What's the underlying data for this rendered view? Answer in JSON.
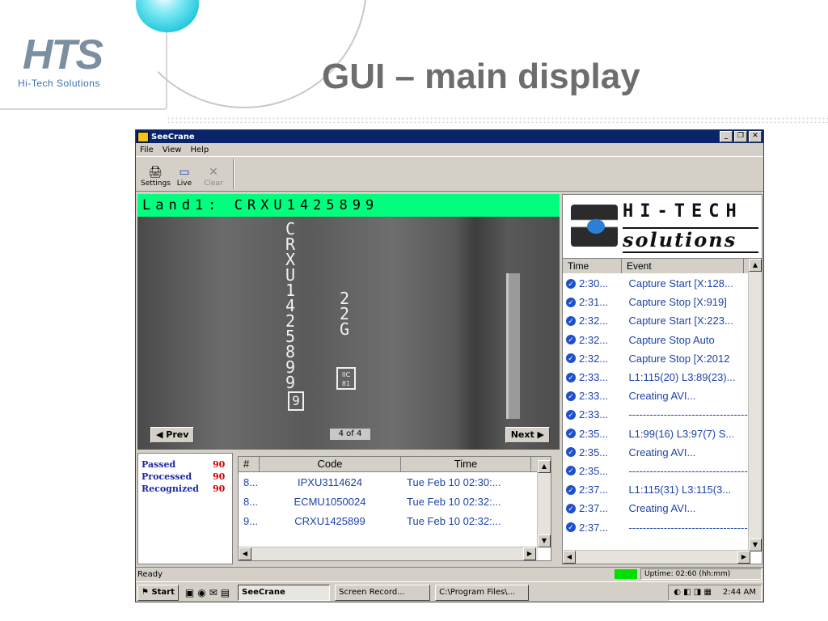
{
  "slide": {
    "logo_mark": "HTS",
    "logo_subtitle": "Hi-Tech Solutions",
    "title": "GUI – main display"
  },
  "window": {
    "title": "SeeCrane",
    "menu": [
      "File",
      "View",
      "Help"
    ],
    "toolbar": {
      "settings": "Settings",
      "live": "Live",
      "clear": "Clear"
    }
  },
  "video": {
    "plate_label": "Land1:  CRXU1425899",
    "vertical_code": "CRXU1425899",
    "side_code": "22G",
    "check_digit": "9",
    "iic_top": "IIC",
    "iic_bottom": "81",
    "prev_label": "◀ Prev",
    "next_label": "Next ▶",
    "counter": "4  of  4"
  },
  "brand": {
    "line1": "HI-TECH",
    "line2": "solutions"
  },
  "events": {
    "columns": [
      "Time",
      "Event"
    ],
    "rows": [
      {
        "time": "2:30...",
        "event": "Capture Start [X:128..."
      },
      {
        "time": "2:31...",
        "event": "Capture Stop [X:919]"
      },
      {
        "time": "2:32...",
        "event": "Capture Start [X:223..."
      },
      {
        "time": "2:32...",
        "event": "Capture Stop Auto"
      },
      {
        "time": "2:32...",
        "event": "Capture Stop [X:2012"
      },
      {
        "time": "2:33...",
        "event": "L1:115(20) L3:89(23)..."
      },
      {
        "time": "2:33...",
        "event": "Creating AVI..."
      },
      {
        "time": "2:33...",
        "event": "------------------------------------"
      },
      {
        "time": "2:35...",
        "event": "L1:99(16) L3:97(7) S..."
      },
      {
        "time": "2:35...",
        "event": "Creating AVI..."
      },
      {
        "time": "2:35...",
        "event": "------------------------------------"
      },
      {
        "time": "2:37...",
        "event": "L1:115(31) L3:115(3..."
      },
      {
        "time": "2:37...",
        "event": "Creating AVI..."
      },
      {
        "time": "2:37...",
        "event": "------------------------------------"
      }
    ]
  },
  "stats": [
    {
      "label": "Passed",
      "value": "90"
    },
    {
      "label": "Processed",
      "value": "90"
    },
    {
      "label": "Recognized",
      "value": "90"
    }
  ],
  "codes": {
    "columns": [
      "#",
      "Code",
      "Time"
    ],
    "rows": [
      {
        "num": "8...",
        "code": "IPXU3114624",
        "time": "Tue Feb 10 02:30:..."
      },
      {
        "num": "8...",
        "code": "ECMU1050024",
        "time": "Tue Feb 10 02:32:..."
      },
      {
        "num": "9...",
        "code": "CRXU1425899",
        "time": "Tue Feb 10 02:32:..."
      }
    ]
  },
  "status": {
    "ready": "Ready",
    "uptime": "Uptime: 02:60 (hh:mm)"
  },
  "taskbar": {
    "start": "Start",
    "tasks": [
      "SeeCrane",
      "Screen Record...",
      "C:\\Program Files\\..."
    ],
    "clock": "2:44 AM"
  },
  "colors": {
    "plate_bg": "#00ff7f",
    "titlebar": "#0a246a",
    "stat_label": "#1e2aa0",
    "stat_value": "#cc0000",
    "list_text": "#1e43a8"
  }
}
